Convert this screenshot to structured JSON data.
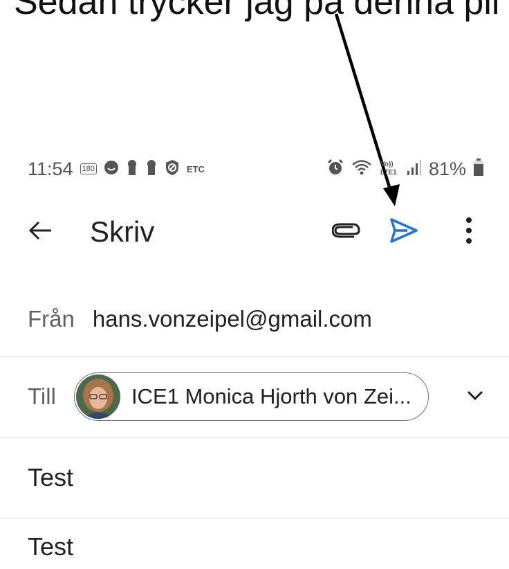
{
  "caption": "Sedan trycker jag på denna pil",
  "status_bar": {
    "time": "11:54",
    "badge_180": "180",
    "etc_label": "ETC",
    "battery_percent": "81%"
  },
  "app_bar": {
    "title": "Skriv",
    "back_icon": "arrow-left-icon",
    "attach_icon": "paperclip-icon",
    "send_icon": "send-icon",
    "more_icon": "more-vert-icon",
    "accent_color": "#1a73e8"
  },
  "compose": {
    "from_label": "Från",
    "from_value": "hans.vonzeipel@gmail.com",
    "to_label": "Till",
    "recipient_chip": "ICE1 Monica Hjorth von Zei...",
    "subject": "Test",
    "body": "Test"
  }
}
